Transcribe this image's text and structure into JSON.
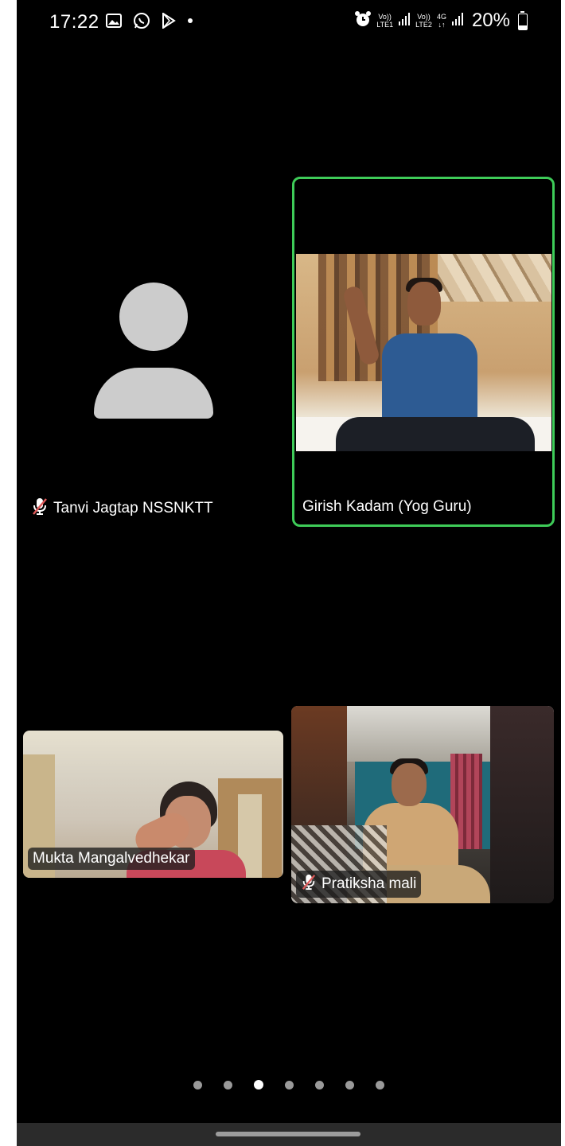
{
  "status_bar": {
    "time": "17:22",
    "left_icons": [
      "gallery-icon",
      "whatsapp-icon",
      "play-store-icon",
      "dot-icon"
    ],
    "sim1_top": "Vo))",
    "sim1_bottom": "LTE1",
    "sim2_top": "Vo))",
    "sim2_bottom": "LTE2",
    "network": "4G",
    "battery": "20%"
  },
  "participants": [
    {
      "name": "Tanvi Jagtap NSSNKTT",
      "muted": true,
      "video": false,
      "active_speaker": false
    },
    {
      "name": "Girish Kadam (Yog Guru)",
      "muted": false,
      "video": true,
      "active_speaker": true
    },
    {
      "name": "Mukta Mangalvedhekar",
      "muted": false,
      "video": true,
      "active_speaker": false
    },
    {
      "name": "Pratiksha mali",
      "muted": true,
      "video": true,
      "active_speaker": false
    }
  ],
  "pagination": {
    "total": 7,
    "current": 3
  },
  "colors": {
    "background": "#000000",
    "active_speaker_border": "#3ecb58",
    "avatar_placeholder": "#cccccc",
    "mute_icon": "#e05a5a"
  }
}
